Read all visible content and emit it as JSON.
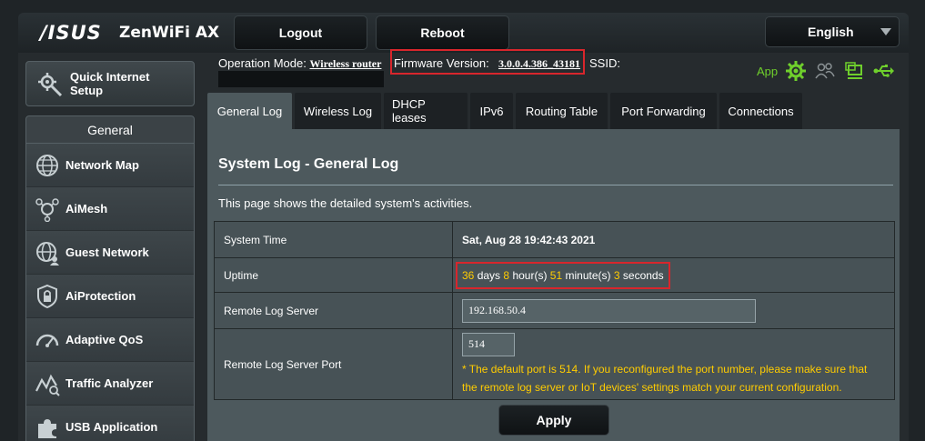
{
  "header": {
    "brand": "/ISUS",
    "model": "ZenWiFi AX",
    "logout_label": "Logout",
    "reboot_label": "Reboot",
    "language": "English"
  },
  "status": {
    "operation_mode_label": "Operation Mode:",
    "operation_mode_value": "Wireless router",
    "firmware_label": "Firmware Version:",
    "firmware_value": "3.0.0.4.386_43181",
    "ssid_label": "SSID:",
    "app_label": "App"
  },
  "sidebar": {
    "qis_label": "Quick Internet Setup",
    "section_title": "General",
    "items": [
      {
        "label": "Network Map",
        "icon": "globe-icon"
      },
      {
        "label": "AiMesh",
        "icon": "aimesh-icon"
      },
      {
        "label": "Guest Network",
        "icon": "guest-globe-icon"
      },
      {
        "label": "AiProtection",
        "icon": "lock-shield-icon"
      },
      {
        "label": "Adaptive QoS",
        "icon": "gauge-icon"
      },
      {
        "label": "Traffic Analyzer",
        "icon": "traffic-icon"
      },
      {
        "label": "USB Application",
        "icon": "puzzle-icon"
      }
    ]
  },
  "tabs": [
    {
      "label": "General Log",
      "active": true
    },
    {
      "label": "Wireless Log",
      "active": false
    },
    {
      "label": "DHCP leases",
      "active": false
    },
    {
      "label": "IPv6",
      "active": false
    },
    {
      "label": "Routing Table",
      "active": false
    },
    {
      "label": "Port Forwarding",
      "active": false
    },
    {
      "label": "Connections",
      "active": false
    }
  ],
  "panel": {
    "title": "System Log - General Log",
    "description": "This page shows the detailed system's activities.",
    "system_time_label": "System Time",
    "system_time_value": "Sat, Aug 28 19:42:43 2021",
    "uptime_label": "Uptime",
    "uptime": {
      "days": "36",
      "days_unit": "days",
      "hours": "8",
      "hours_unit": "hour(s)",
      "minutes": "51",
      "minutes_unit": "minute(s)",
      "seconds": "3",
      "seconds_unit": "seconds"
    },
    "remote_server_label": "Remote Log Server",
    "remote_server_value": "192.168.50.4",
    "remote_port_label": "Remote Log Server Port",
    "remote_port_value": "514",
    "port_note": "* The default port is 514. If you reconfigured the port number, please make sure that the remote log server or IoT devices' settings match your current configuration.",
    "apply_label": "Apply"
  },
  "colors": {
    "accent_yellow": "#ffcc00",
    "highlight_red": "#d8262c",
    "app_green": "#6fcf2c"
  }
}
